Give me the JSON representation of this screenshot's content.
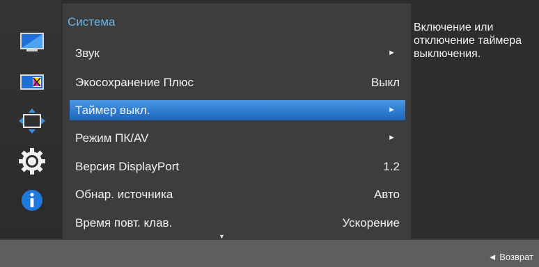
{
  "sidebar": {
    "icons": [
      {
        "name": "picture-icon",
        "active": false
      },
      {
        "name": "color-icon",
        "active": false
      },
      {
        "name": "size-position-icon",
        "active": false
      },
      {
        "name": "system-icon",
        "active": true
      },
      {
        "name": "information-icon",
        "active": false
      }
    ]
  },
  "menu": {
    "title": "Система",
    "items": [
      {
        "label": "Звук",
        "value": "",
        "arrow": "►",
        "selected": false
      },
      {
        "label": "Экосохранение Плюс",
        "value": "Выкл",
        "arrow": "",
        "selected": false
      },
      {
        "label": "Таймер выкл.",
        "value": "",
        "arrow": "►",
        "selected": true
      },
      {
        "label": "Режим ПК/AV",
        "value": "",
        "arrow": "►",
        "selected": false
      },
      {
        "label": "Версия DisplayPort",
        "value": "1.2",
        "arrow": "",
        "selected": false
      },
      {
        "label": "Обнар. источника",
        "value": "Авто",
        "arrow": "",
        "selected": false
      },
      {
        "label": "Время повт. клав.",
        "value": "Ускорение",
        "arrow": "",
        "selected": false
      }
    ],
    "more_indicator": "▼"
  },
  "help": {
    "text": "Включение или отключение таймера выключения."
  },
  "footer": {
    "return_label": "◄ Возврат"
  },
  "colors": {
    "accent": "#2f7cd0",
    "title": "#6bb4e8"
  }
}
